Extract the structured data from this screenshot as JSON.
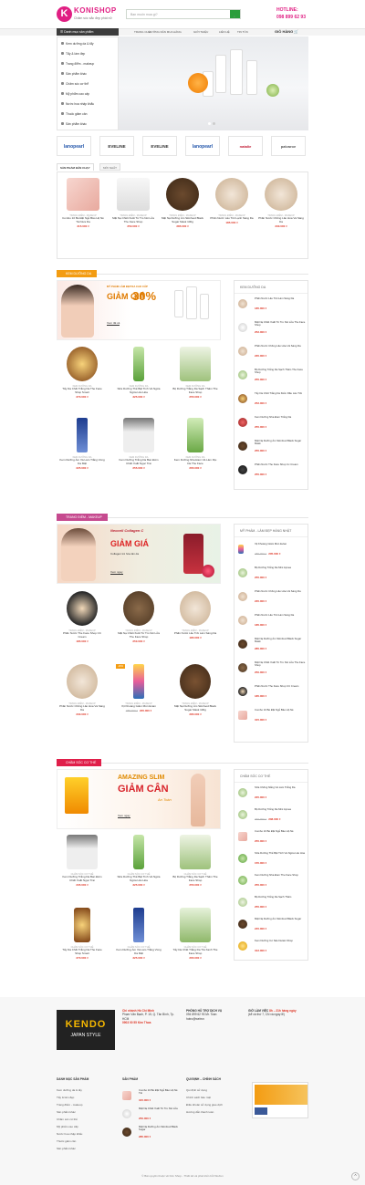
{
  "header": {
    "logo_text": "KONISHOP",
    "tagline": "Chăm sóc sắc đẹp phái nữ",
    "search_placeholder": "Bạn muốn mua gì?",
    "hotline_label": "HOTLINE:",
    "hotline_number": "098 899 62 93"
  },
  "nav": {
    "category_label": "Danh mục sản phẩm",
    "items": [
      "TRANG CHỦ",
      "HƯỚNG DẪN MUA HÀNG",
      "GIỚI THIỆU",
      "LIÊN HỆ",
      "TIN TỨC"
    ],
    "cart_label": "GIỎ HÀNG"
  },
  "sidebar": {
    "items": [
      "Kem dưỡng da & tẩy",
      "Tẩy & làm đẹp",
      "Trang điểm - makeup",
      "Sản phẩm khác",
      "Chăm sóc cơ thể",
      "Mỹ phẩm cao cấp",
      "Nước hoa nhập khẩu",
      "Thuốc giảm cân",
      "Sản phẩm khác"
    ]
  },
  "brands": [
    "lanopearl",
    "EVELINE",
    "EVELINE",
    "lanopearl",
    "natalie",
    "palvaroe"
  ],
  "tabs": [
    "SẢN PHẨM BÁN CHẠY",
    "MỚI NHẤT"
  ],
  "featured": [
    {
      "cat": "TRANG ĐIỂM - MAKEUP",
      "name": "Combo 10 Bé Đặt Ngủ Bảo Hộ Nẻ Tái Nưa Da",
      "price": "315.000 ₫"
    },
    {
      "cat": "TRANG ĐIỂM - MAKEUP",
      "name": "Mặt Nạ Chiết Xuất Từ Tro Núi Lửa The Face Shop",
      "price": "250.000 ₫"
    },
    {
      "cat": "TRANG ĐIỂM - MAKEUP",
      "name": "Mặt Nạ Dưỡng Ẩm Skinfood Black Sugar Mask 100g",
      "price": "285.000 ₫"
    },
    {
      "cat": "TRANG ĐIỂM - MAKEUP",
      "name": "Phấn Nước Lâu Trôi Lạnh Sáng Da",
      "price": "185.000 ₫"
    },
    {
      "cat": "TRANG ĐIỂM - MAKEUP",
      "name": "Phấn Nước Chống Lão Hóa Và Sáng Da",
      "price": "230.000 ₫"
    }
  ],
  "section_skin": {
    "title": "KEM DƯỠNG DA",
    "promo_line": "MỸ PHẨM LÀM ĐẸP DA CAO CẤP",
    "promo_big": "GIẢM GIÁ",
    "promo_pct": "30%",
    "promo_more": "Xem tất cả",
    "products": [
      {
        "cat": "KEM DƯỠNG DA",
        "name": "Tẩy Da Chết Trắng Da The Face Shop Smart",
        "price": "270.000 ₫"
      },
      {
        "cat": "KEM DƯỠNG DA",
        "name": "Sữa Dưỡng Thể Bật Tính Và Ngừa Ngừa Lão Hóa",
        "price": "325.000 ₫"
      },
      {
        "cat": "KEM DƯỠNG DA",
        "name": "Bộ Dưỡng Trắng Da Sạch Thâm The Face Shop",
        "price": "255.000 ₫"
      },
      {
        "cat": "KEM DƯỠNG DA",
        "name": "Kem Dưỡng Ẩm Và Làm Trắng Vùng Da Mặt",
        "price": "225.000 ₫"
      },
      {
        "cat": "KEM DƯỠNG DA",
        "name": "Kem Dưỡng Trắng Da Ban Đêm Chiết Xuất Ngọc Trai",
        "price": "255.000 ₫"
      },
      {
        "cat": "KEM DƯỠNG DA",
        "name": "Kem Dưỡng Nha Đam Và Làm Dịu Da The Face",
        "price": "265.000 ₫"
      }
    ],
    "side_title": "KEM DƯỠNG DA",
    "side_items": [
      {
        "name": "Phấn Nước Lâu Trôi Làm Sáng Da",
        "price": "185.000 ₫"
      },
      {
        "name": "Mặt Nạ Chiết Xuất Từ Tro Núi Lửa The Face Shop",
        "price": "252.000 ₫"
      },
      {
        "name": "Phấn Nước Chống Lão Hóa Và Sáng Da",
        "price": "235.000 ₫"
      },
      {
        "name": "Bộ Dưỡng Trắng Da Sạch Thâm The Face Shop",
        "price": "255.000 ₫"
      },
      {
        "name": "Tẩy Da Chết Trắng Da Kiểm Dầu Lâu Trôi",
        "price": "252.000 ₫"
      },
      {
        "name": "Kem Dưỡng Nha Đam Trắng Da",
        "price": "255.000 ₫"
      },
      {
        "name": "Mặt Nạ Dưỡng Ẩm Skinfood Black Sugar Mask",
        "price": "255.000 ₫"
      },
      {
        "name": "Phấn Nước The Face Shop Cc Cream",
        "price": "255.000 ₫"
      }
    ]
  },
  "section_makeup": {
    "title": "TRANG ĐIỂM - MAKEUP",
    "promo_brand": "Neocell Collagen C",
    "promo_big": "GIẢM GIÁ",
    "promo_sub": "Collagen trẻ hóa làn da",
    "promo_more": "Xem ngay",
    "products": [
      {
        "cat": "TRANG ĐIỂM - MAKEUP",
        "name": "Phấn Nước The Face Shop CC Cream",
        "price": "185.000 ₫"
      },
      {
        "cat": "TRANG ĐIỂM - MAKEUP",
        "name": "Mặt Nạ Chiết Xuất Từ Tro Núi Lửa The Face Shop",
        "price": "250.000 ₫"
      },
      {
        "cat": "TRANG ĐIỂM - MAKEUP",
        "name": "Phấn Nước Lâu Trôi Làm Sáng Da",
        "price": "185.000 ₫"
      },
      {
        "cat": "TRANG ĐIỂM - MAKEUP",
        "name": "Phấn Nước Chống Lão Hóa Và Sáng Da",
        "price": "230.000 ₫"
      },
      {
        "cat": "TRANG ĐIỂM - MAKEUP",
        "name": "Xịt Khoáng Giảm Mùn Evian",
        "old": "285.000 ₫",
        "price": "205.000 ₫",
        "badge": "-30%"
      },
      {
        "cat": "TRANG ĐIỂM - MAKEUP",
        "name": "Mặt Nạ Dưỡng Ẩm Skinfood Black Sugar Mask 100g",
        "price": "285.000 ₫"
      }
    ],
    "side_title": "MỸ PHẨM - LÀM ĐẸP HÀNG NHẬT",
    "side_items": [
      {
        "name": "Xịt Khoáng Giảm Mùn Evian",
        "old": "285.000 ₫",
        "price": "205.000 ₫"
      },
      {
        "name": "Bộ Dưỡng Trắng Da Mini Apnea",
        "price": "255.000 ₫"
      },
      {
        "name": "Phấn Nước Chống Lão Hóa Và Sáng Da",
        "price": "235.000 ₫"
      },
      {
        "name": "Phấn Nước Lâu Trôi Làm Sáng Da",
        "price": "185.000 ₫"
      },
      {
        "name": "Mặt Nạ Dưỡng Ẩm Skinfood Black Sugar Mask",
        "price": "285.000 ₫"
      },
      {
        "name": "Mặt Nạ Chiết Xuất Từ Tro Núi Lửa The Face Shop",
        "price": "250.000 ₫"
      },
      {
        "name": "Phấn Nước The Face Shop CC Cream",
        "price": "185.000 ₫"
      },
      {
        "name": "Combo 10 Bé Đặt Ngủ Bảo Hộ Nẻ",
        "price": "315.000 ₫"
      }
    ]
  },
  "section_body": {
    "title": "CHĂM SÓC CƠ THỂ",
    "promo_big1": "AMAZING SLIM",
    "promo_big2": "GIẢM CÂN",
    "promo_sub": "An Toàn",
    "promo_more": "Xem ngay",
    "products": [
      {
        "cat": "CHĂM SÓC CƠ THỂ",
        "name": "Kem Dưỡng Trắng Da Ban Đêm Chiết Xuất Ngọc Trai",
        "price": "235.000 ₫"
      },
      {
        "cat": "CHĂM SÓC CƠ THỂ",
        "name": "Sữa Dưỡng Thể Bật Tính Và Ngừa Ngừa Lão Hóa",
        "price": "325.000 ₫"
      },
      {
        "cat": "CHĂM SÓC CƠ THỂ",
        "name": "Bộ Dưỡng Trắng Da Sạch Thâm The Face Shop",
        "price": "255.000 ₫"
      },
      {
        "cat": "CHĂM SÓC CƠ THỂ",
        "name": "Tẩy Da Chết Trắng Da The Face Shop Smart",
        "price": "270.000 ₫"
      },
      {
        "cat": "CHĂM SÓC CƠ THỂ",
        "name": "Kem Dưỡng Ẩm Và Làm Trắng Vùng Da Mặt",
        "price": "325.000 ₫"
      },
      {
        "cat": "CHĂM SÓC CƠ THỂ",
        "name": "Tẩy Da Chết Trắng Da Trà Xanh The Face Shop",
        "price": "265.000 ₫"
      }
    ],
    "side_title": "CHĂM SÓC CƠ THỂ",
    "side_items": [
      {
        "name": "Sữa Chống Nắng Và Làm Trắng Da",
        "price": "225.000 ₫"
      },
      {
        "name": "Bộ Dưỡng Trắng Da Mini Apnea",
        "old": "290.000 ₫",
        "price": "208.000 ₫"
      },
      {
        "name": "Combo 10 Bé Đặt Ngủ Bảo Hộ Nẻ",
        "price": "255.000 ₫"
      },
      {
        "name": "Sữa Dưỡng Thể Bật Tính Và Ngừa Lão Hóa",
        "price": "155.000 ₫"
      },
      {
        "name": "Kem Dưỡng Nha Đam The Face Shop",
        "price": "255.000 ₫"
      },
      {
        "name": "Bộ Dưỡng Trắng Da Sạch Thâm",
        "price": "255.000 ₫"
      },
      {
        "name": "Mặt Nạ Dưỡng Ẩm Skinfood Black Sugar",
        "price": "245.000 ₫"
      },
      {
        "name": "Kem Dưỡng Cơ Sâu Detain Shop",
        "price": "312.000 ₫"
      }
    ]
  },
  "footer": {
    "logo1": "KENDO",
    "logo2": "JAPAN STYLE",
    "address_title": "Chi nhánh Hồ Chí Minh",
    "address": "Phạm Văn Bạch, P. 15, Q. Tân Bình, Tp. HCM",
    "phone": "0903 00 55 Kim Thoa",
    "services_title": "PHÒNG HỖ TRỢ DỊCH VỤ",
    "services_phone": "094 899 62 93 Mr. Toàn",
    "services_email": "hotro@webvn",
    "hours_title": "GIỜ LÀM VIỆC",
    "hours": "8h – 21h hàng ngày",
    "hours_note": "(kể cả thứ 7, CN và ngày lễ)",
    "col1_title": "DANH MỤC SẢN PHẨM",
    "col1_items": [
      "Kem dưỡng da & tẩy",
      "Tẩy & làm đẹp",
      "Trang điểm - makeup",
      "Sản phẩm khác",
      "Chăm sóc cơ thể",
      "Mỹ phẩm cao cấp",
      "Nước hoa nhập khẩu",
      "Thuốc giảm cân",
      "Sản phẩm khác"
    ],
    "col2_title": "SẢN PHẨM",
    "col2_items": [
      {
        "name": "Combo 10 Bé Đặt Ngủ Bảo Hộ Nẻ Tái",
        "price": "315.000 ₫"
      },
      {
        "name": "Mặt Nạ Chiết Xuất Từ Tro Núi Lửa",
        "price": "250.000 ₫"
      },
      {
        "name": "Mặt Nạ Dưỡng Ẩm Skinfood Black Sugar",
        "price": "285.000 ₫"
      }
    ],
    "col3_title": "QUI ĐỊNH – CHÍNH SÁCH",
    "col3_items": [
      "Qui định sử dụng",
      "Chính sách bảo mật",
      "Điều khoản sử dụng giao dịch",
      "Hướng dẫn thanh toán"
    ],
    "copyright": "© Bản quyền thuộc về Kôn Shop - Thiết kế và phát triển bởi Webvn"
  },
  "colors": {
    "brand": "#e01f83",
    "accent_orange": "#f39c12",
    "price": "#dd3322",
    "green": "#2a9d3a"
  }
}
